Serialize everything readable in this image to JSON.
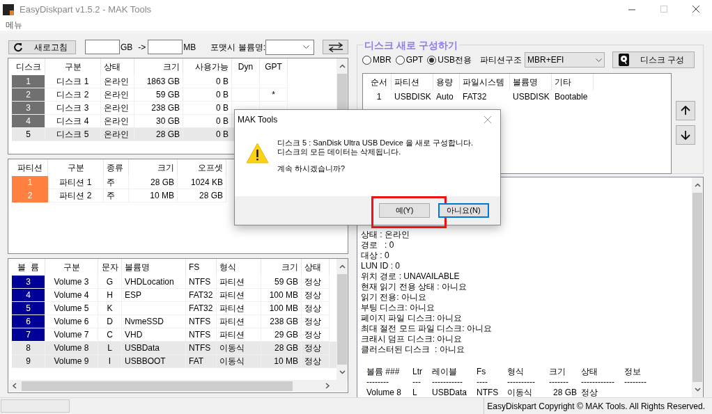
{
  "window": {
    "title": "EasyDiskpart v1.5.2 - MAK Tools"
  },
  "menu": [
    "메뉴"
  ],
  "toolbar": {
    "refresh": "새로고침",
    "gb_unit": "GB",
    "arrow": "->",
    "mb_unit": "MB",
    "volume_label": "포맷시 볼륨명:"
  },
  "disks": {
    "columns": [
      "디스크",
      "구분",
      "상태",
      "크기",
      "사용가능",
      "Dyn",
      "GPT"
    ],
    "rows": [
      {
        "cells": [
          "1",
          "디스크 1",
          "온라인",
          "1863 GB",
          "0 B",
          "",
          ""
        ],
        "selected": false
      },
      {
        "cells": [
          "2",
          "디스크 2",
          "온라인",
          "59 GB",
          "0 B",
          "",
          "*"
        ],
        "selected": false
      },
      {
        "cells": [
          "3",
          "디스크 3",
          "온라인",
          "238 GB",
          "0 B",
          "",
          ""
        ],
        "selected": false
      },
      {
        "cells": [
          "4",
          "디스크 4",
          "온라인",
          "30 GB",
          "0 B",
          "",
          ""
        ],
        "selected": false
      },
      {
        "cells": [
          "5",
          "디스크 5",
          "온라인",
          "28 GB",
          "0 B",
          "",
          ""
        ],
        "selected": true
      }
    ]
  },
  "partitions": {
    "columns": [
      "파티션",
      "구분",
      "종류",
      "크기",
      "오프셋"
    ],
    "rows": [
      {
        "cells": [
          "1",
          "파티션 1",
          "주",
          "28 GB",
          "1024 KB"
        ],
        "color": "#ff8040"
      },
      {
        "cells": [
          "2",
          "파티션 2",
          "주",
          "10 MB",
          "28 GB"
        ],
        "color": "#ff8040"
      }
    ]
  },
  "volumes": {
    "columns": [
      "볼  륨",
      "구분",
      "문자",
      "볼륨명",
      "FS",
      "형식",
      "크기",
      "상태"
    ],
    "rows": [
      {
        "cells": [
          "3",
          "Volume 3",
          "G",
          "VHDLocation",
          "NTFS",
          "파티션",
          "59 GB",
          "정상"
        ],
        "selected": false
      },
      {
        "cells": [
          "4",
          "Volume 4",
          "H",
          "ESP",
          "FAT32",
          "파티션",
          "100 MB",
          "정상"
        ],
        "selected": false
      },
      {
        "cells": [
          "5",
          "Volume 5",
          "K",
          "",
          "FAT32",
          "파티션",
          "100 MB",
          "정상"
        ],
        "selected": false
      },
      {
        "cells": [
          "6",
          "Volume 6",
          "D",
          "NvmeSSD",
          "NTFS",
          "파티션",
          "238 GB",
          "정상"
        ],
        "selected": false
      },
      {
        "cells": [
          "7",
          "Volume 7",
          "C",
          "VHD",
          "NTFS",
          "파티션",
          "29 GB",
          "정상"
        ],
        "selected": false
      },
      {
        "cells": [
          "8",
          "Volume 8",
          "L",
          "USBData",
          "NTFS",
          "이동식",
          "28 GB",
          "정상"
        ],
        "selected": true
      },
      {
        "cells": [
          "9",
          "Volume 9",
          "I",
          "USBBOOT",
          "FAT",
          "이동식",
          "10 MB",
          "정상"
        ],
        "selected": true
      }
    ]
  },
  "rebuild": {
    "title": "디스크 새로 구성하기",
    "schemes": [
      {
        "label": "MBR",
        "selected": false
      },
      {
        "label": "GPT",
        "selected": false
      },
      {
        "label": "USB전용",
        "selected": true
      }
    ],
    "structure_label": "파티션구조",
    "structure": "MBR+EFI",
    "build_button": "디스크 구성",
    "columns": [
      "순서",
      "파티션",
      "용량",
      "파일시스템",
      "볼륨명",
      "기타"
    ],
    "rows": [
      [
        "1",
        "USBDISK",
        "Auto",
        "FAT32",
        "USBDISK",
        "Bootable"
      ]
    ]
  },
  "info": {
    "lines": [
      "상태 : 온라인",
      "경로   : 0",
      "대상 : 0",
      "LUN ID : 0",
      "위치 경로 : UNAVAILABLE",
      "현재 읽기 전용 상태 : 아니요",
      "읽기 전용: 아니요",
      "부팅 디스크: 아니요",
      "페이지 파일 디스크: 아니요",
      "최대 절전 모드 파일 디스크: 아니요",
      "크래시 덤프 디스크: 아니요",
      "클러스터된 디스크  : 아니요"
    ],
    "columns": [
      "볼륨 ###",
      "Ltr",
      "레이블",
      "Fs",
      "형식",
      "크기",
      "상태",
      "정보"
    ],
    "dashes": [
      "--------",
      "---",
      "-----------",
      "----",
      "----------",
      "-------",
      "------------",
      "--------"
    ],
    "rows": [
      [
        "Volume 8",
        "L",
        "USBData",
        "NTFS",
        "이동식",
        "28 GB",
        "정상",
        ""
      ]
    ]
  },
  "status_bar": "EasyDiskpart Copyright © MAK Tools. All Rights Reserved.",
  "dialog": {
    "title": "MAK Tools",
    "message": [
      "디스크 5 : SanDisk Ultra USB Device 을 새로 구성합니다.",
      "디스크의 모든 데이터는 삭제됩니다."
    ],
    "question": "계속 하시겠습니까?",
    "buttons": [
      {
        "label": "예(Y)",
        "highlighted": true,
        "focused": false
      },
      {
        "label": "아니요(N)",
        "highlighted": false,
        "focused": true
      }
    ]
  }
}
